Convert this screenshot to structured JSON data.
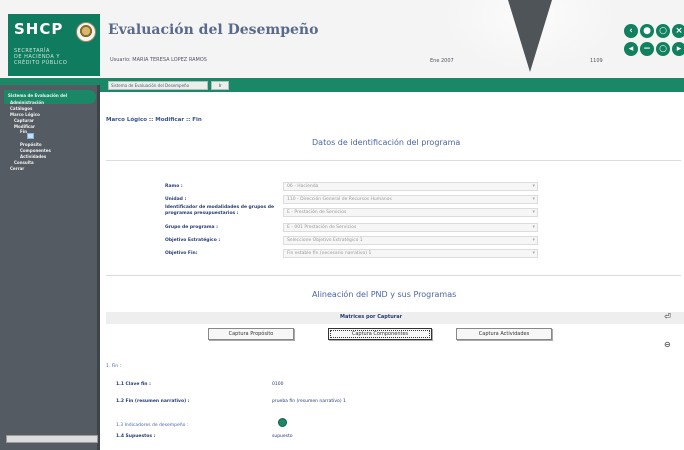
{
  "header": {
    "logo": "SHCP",
    "agency_lines": [
      "SECRETARÍA",
      "DE HACIENDA Y",
      "CRÉDITO PÚBLICO"
    ],
    "app_title": "Evaluación del Desempeño",
    "user_line": "Usuario: MARIA TERESA LOPEZ RAMOS",
    "date": "Ene 2007",
    "user_id": "1109"
  },
  "window_controls": {
    "top": [
      "chevron-left",
      "circle",
      "circle",
      "close"
    ],
    "bottom": [
      "back",
      "minus",
      "circle",
      "circle"
    ]
  },
  "module_bar": {
    "select_value": "Sistema de Evaluación del Desempeño",
    "go_label": "Ir"
  },
  "sidebar": {
    "items": [
      "Sistema de Evaluación del",
      "Administración",
      "Catálogos",
      "Marco Lógico",
      "Capturar",
      "Modificar",
      "Fin",
      "Propósito",
      "Componentes",
      "Actividades",
      "Consulta",
      "Cerrar"
    ]
  },
  "breadcrumb": "Marco Lógico :: Modificar :: Fin",
  "section1": {
    "title": "Datos de identificación del programa"
  },
  "form": {
    "rows": [
      {
        "label": "Ramo :",
        "value": "06 - Hacienda"
      },
      {
        "label": "Unidad :",
        "value": "110 - Dirección General de Recursos Humanos"
      },
      {
        "label": "Identificador de modalidades de grupos de programas presupuestarios :",
        "value": "E - Prestación de Servicios"
      },
      {
        "label": "Grupo de programa :",
        "value": "E - 001 Prestación de Servicios"
      },
      {
        "label": "Objetivo Estratégico :",
        "value": "Seleccione Objetivo Estratégico 1"
      },
      {
        "label": "Objetivo Fin:",
        "value": "Fin estable fin (necesario narrativo) 1"
      }
    ]
  },
  "section2": {
    "title": "Alineación del PND y sus Programas"
  },
  "matrix": {
    "label": "Matrices por Capturar",
    "buttons": [
      "Captura Propósito",
      "Captura Componentes",
      "Captura Actividades"
    ]
  },
  "fin_section": {
    "title": "1. Fin :",
    "rows": [
      {
        "label": "1.1 Clave fin :",
        "value": "0100"
      },
      {
        "label": "1.2 Fin (resumen narrativo) :",
        "value": "prueba fin (resumen narrativo) 1"
      },
      {
        "label": "1.3 Indicadores de desempeño :",
        "value": ""
      },
      {
        "label": "1.4 Supuestos :",
        "value": "supuesto"
      }
    ]
  },
  "colors": {
    "brand_green": "#1a8866",
    "sidebar_gray": "#555b62",
    "text_blue": "#243a75"
  }
}
